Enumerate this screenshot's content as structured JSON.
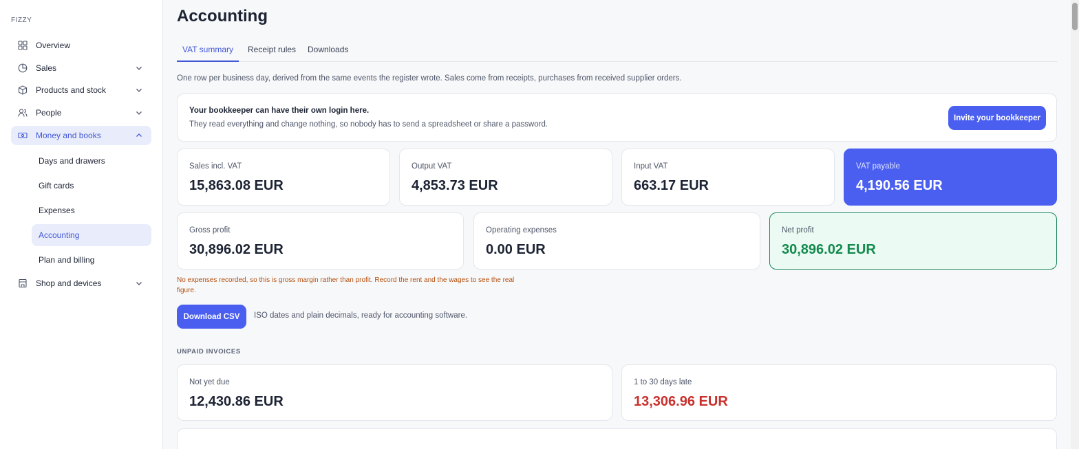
{
  "brand": "FIZZY",
  "nav": {
    "overview": "Overview",
    "sales": "Sales",
    "products": "Products and stock",
    "people": "People",
    "money": "Money and books",
    "shop": "Shop and devices",
    "sub": {
      "days": "Days and drawers",
      "gift": "Gift cards",
      "expenses": "Expenses",
      "accounting": "Accounting",
      "plan": "Plan and billing"
    }
  },
  "page": {
    "title": "Accounting",
    "tabs": [
      "VAT summary",
      "Receipt rules",
      "Downloads"
    ],
    "intro": "One row per business day, derived from the same events the register wrote. Sales come from receipts, purchases from received supplier orders."
  },
  "banner": {
    "title": "Your bookkeeper can have their own login here.",
    "subtitle": "They read everything and change nothing, so nobody has to send a spreadsheet or share a password.",
    "button": "Invite your bookkeeper"
  },
  "stats": {
    "sales_incl_vat": {
      "label": "Sales incl. VAT",
      "value": "15,863.08 EUR"
    },
    "output_vat": {
      "label": "Output VAT",
      "value": "4,853.73 EUR"
    },
    "input_vat": {
      "label": "Input VAT",
      "value": "663.17 EUR"
    },
    "vat_payable": {
      "label": "VAT payable",
      "value": "4,190.56 EUR"
    },
    "gross_profit": {
      "label": "Gross profit",
      "value": "30,896.02 EUR"
    },
    "operating_expenses": {
      "label": "Operating expenses",
      "value": "0.00 EUR"
    },
    "net_profit": {
      "label": "Net profit",
      "value": "30,896.02 EUR"
    }
  },
  "warning": "No expenses recorded, so this is gross margin rather than profit. Record the rent and the wages to see the real figure.",
  "csv": {
    "button": "Download CSV",
    "note": "ISO dates and plain decimals, ready for accounting software."
  },
  "unpaid": {
    "heading": "UNPAID INVOICES",
    "not_due": {
      "label": "Not yet due",
      "value": "12,430.86 EUR"
    },
    "late": {
      "label": "1 to 30 days late",
      "value": "13,306.96 EUR"
    }
  },
  "colors": {
    "accent": "#4a5ff0",
    "active_nav_bg": "#e9edfb",
    "net_profit_green": "#138a4e",
    "late_red": "#c9302c",
    "warning_orange": "#b4500e"
  },
  "icons": {
    "overview": "grid-icon",
    "sales": "pie-chart-icon",
    "products": "box-icon",
    "people": "users-icon",
    "money": "banknote-icon",
    "shop": "store-icon"
  }
}
